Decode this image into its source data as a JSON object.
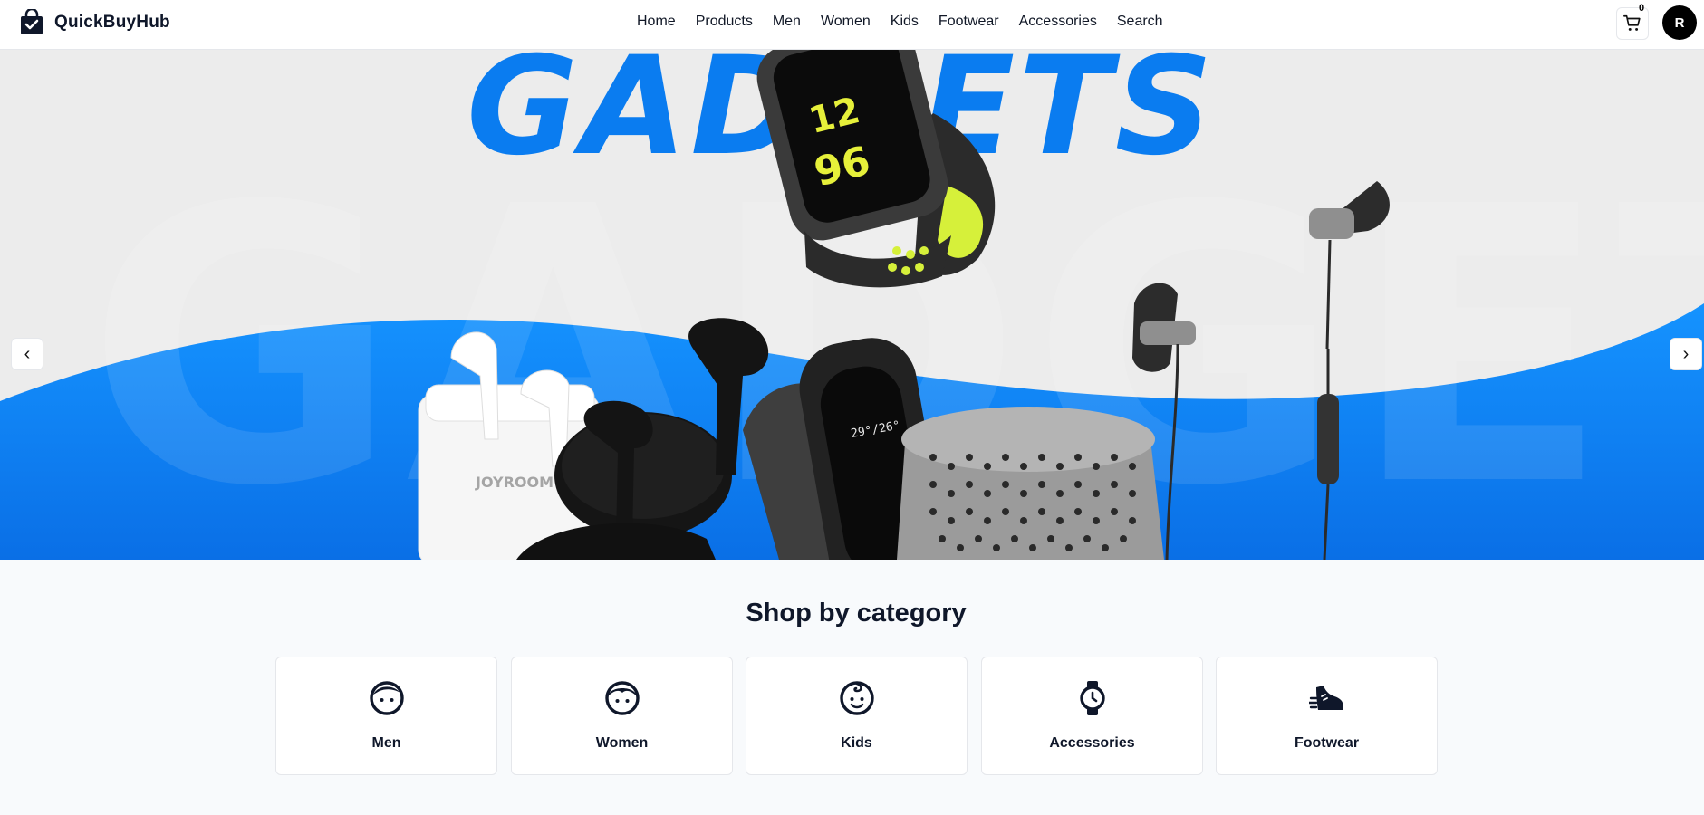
{
  "app": {
    "brand": "QuickBuyHub"
  },
  "nav": {
    "items": [
      {
        "label": "Home"
      },
      {
        "label": "Products"
      },
      {
        "label": "Men"
      },
      {
        "label": "Women"
      },
      {
        "label": "Kids"
      },
      {
        "label": "Footwear"
      },
      {
        "label": "Accessories"
      },
      {
        "label": "Search"
      }
    ]
  },
  "cart": {
    "count": "0",
    "icon": "cart-icon"
  },
  "user": {
    "avatar_initial": "R"
  },
  "hero": {
    "banner_text": "GADGETS",
    "products": [
      "smartwatch",
      "earbuds",
      "earbuds-case",
      "fitness-band",
      "bluetooth-speaker",
      "earphones"
    ],
    "brand_marks": {
      "case": "JOYROOM"
    },
    "prev_icon": "‹",
    "next_icon": "›"
  },
  "categories": {
    "title": "Shop by category",
    "items": [
      {
        "label": "Men",
        "icon": "man-face-icon"
      },
      {
        "label": "Women",
        "icon": "woman-face-icon"
      },
      {
        "label": "Kids",
        "icon": "kid-face-icon"
      },
      {
        "label": "Accessories",
        "icon": "watch-icon"
      },
      {
        "label": "Footwear",
        "icon": "shoe-icon"
      }
    ]
  },
  "colors": {
    "accent_blue": "#0a7cf0",
    "hero_background": "#ececec",
    "page_background": "#f8fafc"
  }
}
